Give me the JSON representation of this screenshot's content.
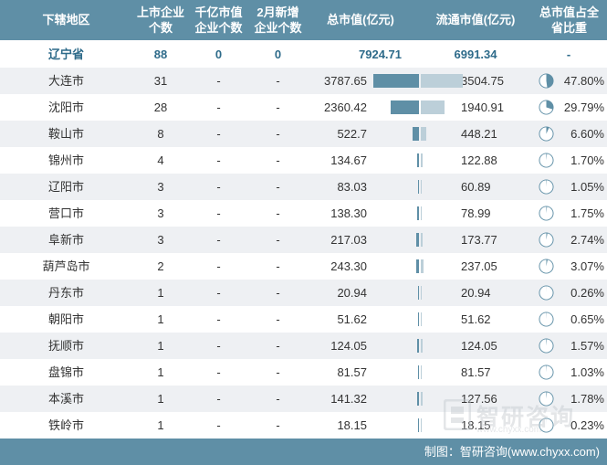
{
  "chart_data": {
    "type": "table",
    "headers": {
      "region": "下辖地区",
      "listed_companies": [
        "上市企业",
        "个数"
      ],
      "billion_companies": [
        "千亿市值",
        "企业个数"
      ],
      "feb_new": [
        "2月新增",
        "企业个数"
      ],
      "total_cap": "总市值(亿元)",
      "float_cap": "流通市值(亿元)",
      "share": [
        "总市值占全",
        "省比重"
      ]
    },
    "total": {
      "name": "辽宁省",
      "count": "88",
      "b1": "0",
      "b2": "0",
      "cap": "7924.71",
      "flt": "6991.34",
      "pct": "-"
    },
    "rows": [
      {
        "name": "大连市",
        "count": "31",
        "b1": "-",
        "b2": "-",
        "cap": "3787.65",
        "flt": "3504.75",
        "pct": "47.80%",
        "capv": 3787.65,
        "fltv": 3504.75,
        "share": 0.478
      },
      {
        "name": "沈阳市",
        "count": "28",
        "b1": "-",
        "b2": "-",
        "cap": "2360.42",
        "flt": "1940.91",
        "pct": "29.79%",
        "capv": 2360.42,
        "fltv": 1940.91,
        "share": 0.2979
      },
      {
        "name": "鞍山市",
        "count": "8",
        "b1": "-",
        "b2": "-",
        "cap": "522.7",
        "flt": "448.21",
        "pct": "6.60%",
        "capv": 522.7,
        "fltv": 448.21,
        "share": 0.066
      },
      {
        "name": "锦州市",
        "count": "4",
        "b1": "-",
        "b2": "-",
        "cap": "134.67",
        "flt": "122.88",
        "pct": "1.70%",
        "capv": 134.67,
        "fltv": 122.88,
        "share": 0.017
      },
      {
        "name": "辽阳市",
        "count": "3",
        "b1": "-",
        "b2": "-",
        "cap": "83.03",
        "flt": "60.89",
        "pct": "1.05%",
        "capv": 83.03,
        "fltv": 60.89,
        "share": 0.0105
      },
      {
        "name": "营口市",
        "count": "3",
        "b1": "-",
        "b2": "-",
        "cap": "138.30",
        "flt": "78.99",
        "pct": "1.75%",
        "capv": 138.3,
        "fltv": 78.99,
        "share": 0.0175
      },
      {
        "name": "阜新市",
        "count": "3",
        "b1": "-",
        "b2": "-",
        "cap": "217.03",
        "flt": "173.77",
        "pct": "2.74%",
        "capv": 217.03,
        "fltv": 173.77,
        "share": 0.0274
      },
      {
        "name": "葫芦岛市",
        "count": "2",
        "b1": "-",
        "b2": "-",
        "cap": "243.30",
        "flt": "237.05",
        "pct": "3.07%",
        "capv": 243.3,
        "fltv": 237.05,
        "share": 0.0307
      },
      {
        "name": "丹东市",
        "count": "1",
        "b1": "-",
        "b2": "-",
        "cap": "20.94",
        "flt": "20.94",
        "pct": "0.26%",
        "capv": 20.94,
        "fltv": 20.94,
        "share": 0.0026
      },
      {
        "name": "朝阳市",
        "count": "1",
        "b1": "-",
        "b2": "-",
        "cap": "51.62",
        "flt": "51.62",
        "pct": "0.65%",
        "capv": 51.62,
        "fltv": 51.62,
        "share": 0.0065
      },
      {
        "name": "抚顺市",
        "count": "1",
        "b1": "-",
        "b2": "-",
        "cap": "124.05",
        "flt": "124.05",
        "pct": "1.57%",
        "capv": 124.05,
        "fltv": 124.05,
        "share": 0.0157
      },
      {
        "name": "盘锦市",
        "count": "1",
        "b1": "-",
        "b2": "-",
        "cap": "81.57",
        "flt": "81.57",
        "pct": "1.03%",
        "capv": 81.57,
        "fltv": 81.57,
        "share": 0.0103
      },
      {
        "name": "本溪市",
        "count": "1",
        "b1": "-",
        "b2": "-",
        "cap": "141.32",
        "flt": "127.56",
        "pct": "1.78%",
        "capv": 141.32,
        "fltv": 127.56,
        "share": 0.0178
      },
      {
        "name": "铁岭市",
        "count": "1",
        "b1": "-",
        "b2": "-",
        "cap": "18.15",
        "flt": "18.15",
        "pct": "0.23%",
        "capv": 18.15,
        "fltv": 18.15,
        "share": 0.0023
      }
    ],
    "colors": {
      "header": "#5f8fa6",
      "bar_total": "#5f8fa6",
      "bar_float": "#bccfd9",
      "total_text": "#2e6b8a",
      "row_alt": "#eef0f3"
    }
  },
  "footer": {
    "source": "制图：智研咨询(www.chyxx.com)"
  },
  "watermark": {
    "name": "智研咨询",
    "url": "www.chyxx.com"
  }
}
